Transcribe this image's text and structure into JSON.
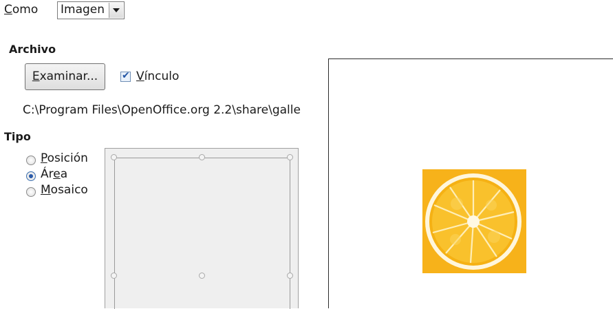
{
  "como": {
    "label_pre": "",
    "label_key": "C",
    "label_post": "omo",
    "selected": "Imagen"
  },
  "archivo": {
    "heading": "Archivo",
    "browse_key": "E",
    "browse_post": "xaminar...",
    "link_pre": "",
    "link_key": "V",
    "link_post": "ínculo",
    "link_checked": true,
    "path": "C:\\Program Files\\OpenOffice.org 2.2\\share\\galle"
  },
  "tipo": {
    "heading": "Tipo",
    "options": [
      {
        "pre": "",
        "key": "P",
        "post": "osición",
        "selected": false
      },
      {
        "pre": "Ár",
        "key": "e",
        "post": "a",
        "selected": true
      },
      {
        "pre": "",
        "key": "M",
        "post": "osaico",
        "selected": false
      }
    ]
  },
  "preview": {
    "image": "orange-slice"
  },
  "colors": {
    "orange_bg": "#f7b21a",
    "accent": "#2a5aa8"
  }
}
